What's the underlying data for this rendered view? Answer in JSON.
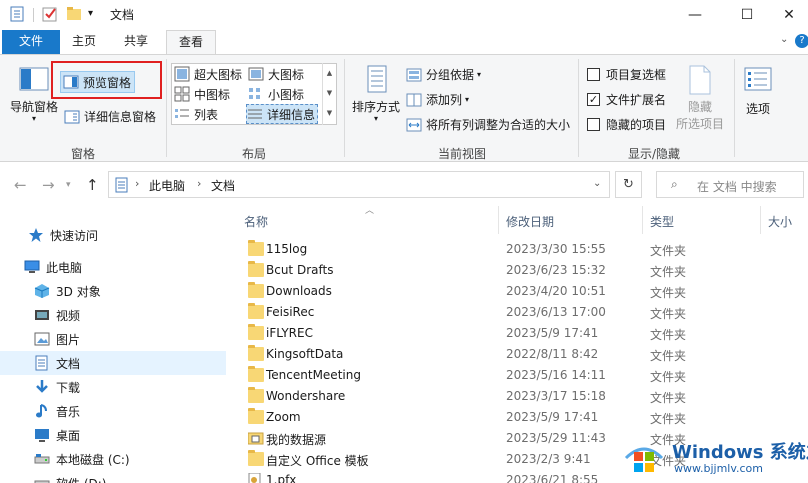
{
  "window": {
    "title": "文档",
    "minimize": "—",
    "maximize": "☐",
    "close": "✕"
  },
  "ribbon_tabs": {
    "file": "文件",
    "home": "主页",
    "share": "共享",
    "view": "查看"
  },
  "ribbon": {
    "panes": {
      "nav_pane": "导航窗格",
      "preview_pane": "预览窗格",
      "details_pane": "详细信息窗格",
      "label": "窗格"
    },
    "layout": {
      "extra_large": "超大图标",
      "large": "大图标",
      "medium": "中图标",
      "small": "小图标",
      "list": "列表",
      "details": "详细信息",
      "label": "布局"
    },
    "current_view": {
      "sort_by": "排序方式",
      "group_by": "分组依据",
      "add_column": "添加列",
      "size_all_columns": "将所有列调整为合适的大小",
      "label": "当前视图"
    },
    "show_hide": {
      "item_checkboxes": "项目复选框",
      "file_extensions": "文件扩展名",
      "hidden_items": "隐藏的项目",
      "hide_selected_1": "隐藏",
      "hide_selected_2": "所选项目",
      "label": "显示/隐藏",
      "item_checkboxes_checked": false,
      "file_extensions_checked": true,
      "hidden_items_checked": false
    },
    "options": "选项"
  },
  "address": {
    "crumbs": [
      "此电脑",
      "文档"
    ],
    "search_placeholder": "在 文档 中搜索"
  },
  "nav_pane": {
    "items": [
      {
        "label": "快速访问",
        "icon": "star-icon"
      },
      {
        "label": "此电脑",
        "icon": "computer-icon"
      },
      {
        "label": "3D 对象",
        "icon": "cube-icon"
      },
      {
        "label": "视频",
        "icon": "video-icon"
      },
      {
        "label": "图片",
        "icon": "picture-icon"
      },
      {
        "label": "文档",
        "icon": "document-icon"
      },
      {
        "label": "下载",
        "icon": "download-icon"
      },
      {
        "label": "音乐",
        "icon": "music-icon"
      },
      {
        "label": "桌面",
        "icon": "desktop-icon"
      },
      {
        "label": "本地磁盘 (C:)",
        "icon": "drive-icon"
      },
      {
        "label": "软件 (D:)",
        "icon": "drive-icon"
      }
    ]
  },
  "columns": {
    "name": "名称",
    "date": "修改日期",
    "type": "类型",
    "size": "大小"
  },
  "files": [
    {
      "name": "115log",
      "date": "2023/3/30 15:55",
      "type": "文件夹",
      "kind": "folder"
    },
    {
      "name": "Bcut Drafts",
      "date": "2023/6/23 15:32",
      "type": "文件夹",
      "kind": "folder"
    },
    {
      "name": "Downloads",
      "date": "2023/4/20 10:51",
      "type": "文件夹",
      "kind": "folder"
    },
    {
      "name": "FeisiRec",
      "date": "2023/6/13 17:00",
      "type": "文件夹",
      "kind": "folder"
    },
    {
      "name": "iFLYREC",
      "date": "2023/5/9 17:41",
      "type": "文件夹",
      "kind": "folder"
    },
    {
      "name": "KingsoftData",
      "date": "2022/8/11 8:42",
      "type": "文件夹",
      "kind": "folder"
    },
    {
      "name": "TencentMeeting",
      "date": "2023/5/16 14:11",
      "type": "文件夹",
      "kind": "folder"
    },
    {
      "name": "Wondershare",
      "date": "2023/3/17 15:18",
      "type": "文件夹",
      "kind": "folder"
    },
    {
      "name": "Zoom",
      "date": "2023/5/9 17:41",
      "type": "文件夹",
      "kind": "folder"
    },
    {
      "name": "我的数据源",
      "date": "2023/5/29 11:43",
      "type": "文件夹",
      "kind": "special"
    },
    {
      "name": "自定义 Office 模板",
      "date": "2023/2/3 9:41",
      "type": "文件夹",
      "kind": "folder"
    },
    {
      "name": "1.pfx",
      "date": "2023/6/21 8:55",
      "type": "",
      "kind": "file"
    }
  ],
  "watermark": {
    "title": "Windows 系统之家",
    "url": "www.bjjmlv.com"
  },
  "colors": {
    "accent": "#1979ca",
    "highlight": "#e02020",
    "folder": "#f8d775"
  }
}
